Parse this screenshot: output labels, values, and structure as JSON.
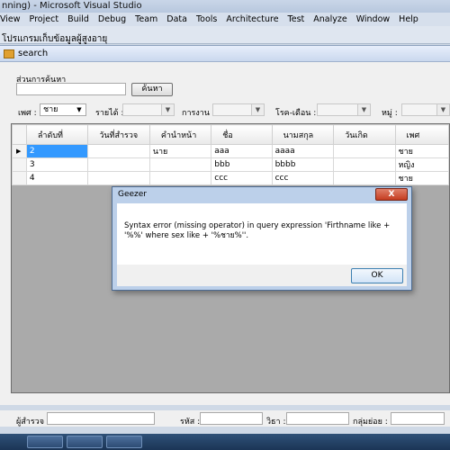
{
  "vs": {
    "title": "nning) - Microsoft Visual Studio",
    "menu": [
      "View",
      "Project",
      "Build",
      "Debug",
      "Team",
      "Data",
      "Tools",
      "Architecture",
      "Test",
      "Analyze",
      "Window",
      "Help"
    ],
    "designer_label": "โปรแกรมเก็บข้อมูลผู้สูงอายุ"
  },
  "form": {
    "title": "search",
    "section_label": "ส่วนการค้นหา",
    "search_value": "",
    "search_button": "ค้นหา",
    "filters": {
      "sex_label": "เพศ :",
      "sex_value": "ชาย",
      "income_label": "รายได้ :",
      "work_label": "การงาน :",
      "disease_label": "โรค-เดือน :",
      "village_label": "หมู่ :"
    }
  },
  "grid": {
    "columns": [
      "ลำดับที่",
      "วันที่สำรวจ",
      "คำนำหน้า",
      "ชื่อ",
      "นามสกุล",
      "วันเกิด",
      "เพศ"
    ],
    "rows": [
      {
        "id": "2",
        "date": "",
        "prefix": "นาย",
        "name": "aaa",
        "surname": "aaaa",
        "birth": "",
        "sex": "ชาย"
      },
      {
        "id": "3",
        "date": "",
        "prefix": "",
        "name": "bbb",
        "surname": "bbbb",
        "birth": "",
        "sex": "หญิง"
      },
      {
        "id": "4",
        "date": "",
        "prefix": "",
        "name": "ccc",
        "surname": "ccc",
        "birth": "",
        "sex": "ชาย"
      }
    ]
  },
  "statusbar": {
    "surveyor_label": "ผู้สำรวจ :",
    "code_label": "รหัส :",
    "age_label": "วิธา :",
    "subgroup_label": "กลุ่มย่อย :"
  },
  "dialog": {
    "title": "Geezer",
    "close_label": "X",
    "message": "Syntax error (missing operator) in query expression 'Firthname like + '%%' where sex like + '%ชาย%''.",
    "ok_label": "OK"
  }
}
